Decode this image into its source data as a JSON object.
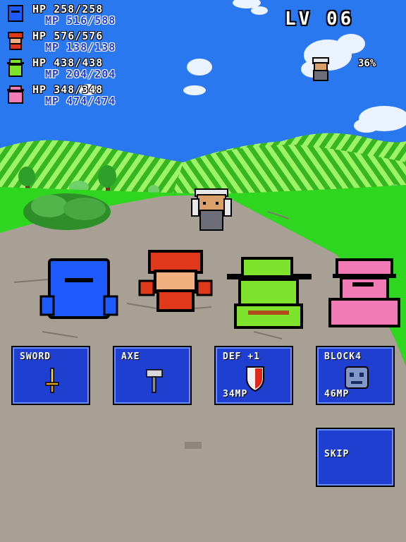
{
  "party": [
    {
      "name": "blue",
      "hp": "HP 258/258",
      "mp": "MP 516/588",
      "color": "#1d5bff"
    },
    {
      "name": "red",
      "hp": "HP 576/576",
      "mp": "MP 138/138",
      "color": "#e0381a"
    },
    {
      "name": "green",
      "hp": "HP 438/438",
      "mp": "MP 204/204",
      "color": "#7ee32c"
    },
    {
      "name": "pink",
      "hp": "HP 348/348",
      "mp": "MP 474/474",
      "color": "#f27ab5"
    }
  ],
  "level": "LV 06",
  "enemy": {
    "percent": "36%"
  },
  "commands": {
    "sword": {
      "label": "SWORD",
      "icon": "sword-icon"
    },
    "axe": {
      "label": "AXE",
      "icon": "axe-icon"
    },
    "def": {
      "label": "DEF +1",
      "cost": "34MP",
      "icon": "shield-icon"
    },
    "block": {
      "label": "BLOCK4",
      "cost": "46MP",
      "icon": "block-icon"
    },
    "skip": {
      "label": "SKIP"
    }
  },
  "colors": {
    "sky": "#2a78f0",
    "grass": "#2fd620",
    "road": "#a89f95",
    "button": "#1f3fd0"
  }
}
